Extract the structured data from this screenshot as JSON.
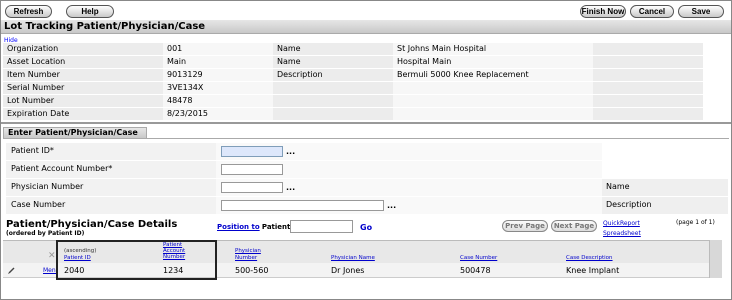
{
  "toolbar": {
    "refresh": "Refresh",
    "help": "Help",
    "finish_now": "Finish Now",
    "cancel": "Cancel",
    "save": "Save"
  },
  "page_title": "Lot Tracking Patient/Physician/Case",
  "hide_link": "Hide",
  "info": {
    "organization_label": "Organization",
    "organization_value": "001",
    "asset_location_label": "Asset Location",
    "asset_location_value": "Main",
    "item_number_label": "Item Number",
    "item_number_value": "9013129",
    "serial_number_label": "Serial Number",
    "serial_number_value": "3VE134X",
    "lot_number_label": "Lot Number",
    "lot_number_value": "48478",
    "expiration_date_label": "Expiration Date",
    "expiration_date_value": "8/23/2015",
    "name_label_1": "Name",
    "name_value_1": "St Johns Main Hospital",
    "name_label_2": "Name",
    "name_value_2": "Hospital Main",
    "description_label": "Description",
    "description_value": "Bermuli 5000 Knee Replacement"
  },
  "enter_section": {
    "title": "Enter Patient/Physician/Case",
    "patient_id_label": "Patient ID*",
    "patient_account_label": "Patient Account Number*",
    "physician_number_label": "Physician Number",
    "case_number_label": "Case Number",
    "name_label": "Name",
    "description_label": "Description",
    "lookup_dots": "..."
  },
  "details": {
    "title": "Patient/Physician/Case Details",
    "subtitle": "(ordered by Patient ID)",
    "position_to_link": "Position to",
    "position_to_field": "Patient ID",
    "go": "Go",
    "prev_page": "Prev Page",
    "next_page": "Next Page",
    "quick_report": "QuickReport",
    "spreadsheet": "Spreadsheet",
    "page_info": "(page 1 of 1)",
    "columns": {
      "ascending": "(ascending)",
      "patient_id": "Patient ID",
      "patient_account_number_1": "Patient",
      "patient_account_number_2": "Account",
      "patient_account_number_3": "Number",
      "physician_number_1": "Physician",
      "physician_number_2": "Number",
      "physician_name": "Physician Name",
      "case_number": "Case Number",
      "case_description": "Case Description"
    },
    "row": {
      "menu": "Menu",
      "patient_id": "2040",
      "patient_account_number": "1234",
      "physician_number": "500-560",
      "physician_name": "Dr Jones",
      "case_number": "500478",
      "case_description": "Knee Implant"
    }
  }
}
